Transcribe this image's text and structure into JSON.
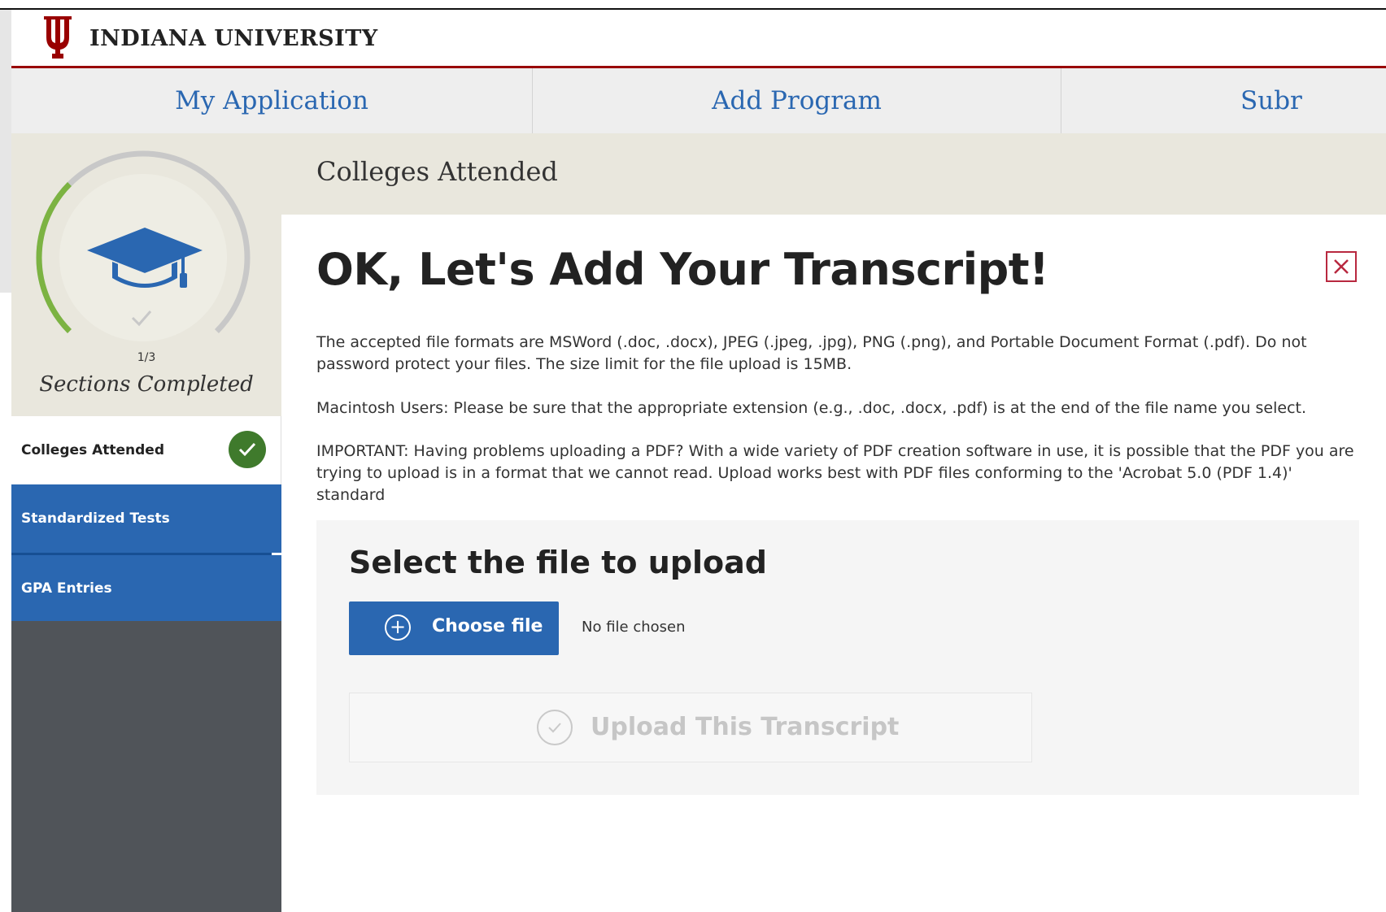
{
  "brand": {
    "name": "INDIANA UNIVERSITY",
    "color": "#990000"
  },
  "nav": {
    "tabs": [
      {
        "label": "My Application"
      },
      {
        "label": "Add Program"
      },
      {
        "label": "Subr"
      }
    ]
  },
  "progress": {
    "fraction": "1/3",
    "completed": 1,
    "total": 3,
    "label": "Sections Completed",
    "icon": "graduation-cap-icon",
    "accent": "#7cb342"
  },
  "sidebar": {
    "items": [
      {
        "label": "Colleges Attended",
        "completed": true,
        "active": true
      },
      {
        "label": "Standardized Tests",
        "completed": false,
        "active": false
      },
      {
        "label": "GPA Entries",
        "completed": false,
        "active": false
      }
    ]
  },
  "section": {
    "title": "Colleges Attended"
  },
  "modal": {
    "title": "OK, Let's Add Your Transcript!",
    "close_icon": "close-icon",
    "paragraphs": [
      "The accepted file formats are MSWord (.doc, .docx), JPEG (.jpeg, .jpg), PNG (.png), and Portable Document Format (.pdf). Do not password protect your files. The size limit for the file upload is 15MB.",
      "Macintosh Users: Please be sure that the appropriate extension (e.g., .doc, .docx, .pdf) is at the end of the file name you select.",
      "IMPORTANT: Having problems uploading a PDF? With a wide variety of PDF creation software in use, it is possible that the PDF you are trying to upload is in a format that we cannot read. Upload works best with PDF files conforming to the 'Acrobat 5.0 (PDF 1.4)' standard"
    ]
  },
  "upload": {
    "heading": "Select the file to upload",
    "choose_label": "Choose file",
    "status": "No file chosen",
    "submit_label": "Upload This Transcript",
    "primary_color": "#2a67b1"
  }
}
